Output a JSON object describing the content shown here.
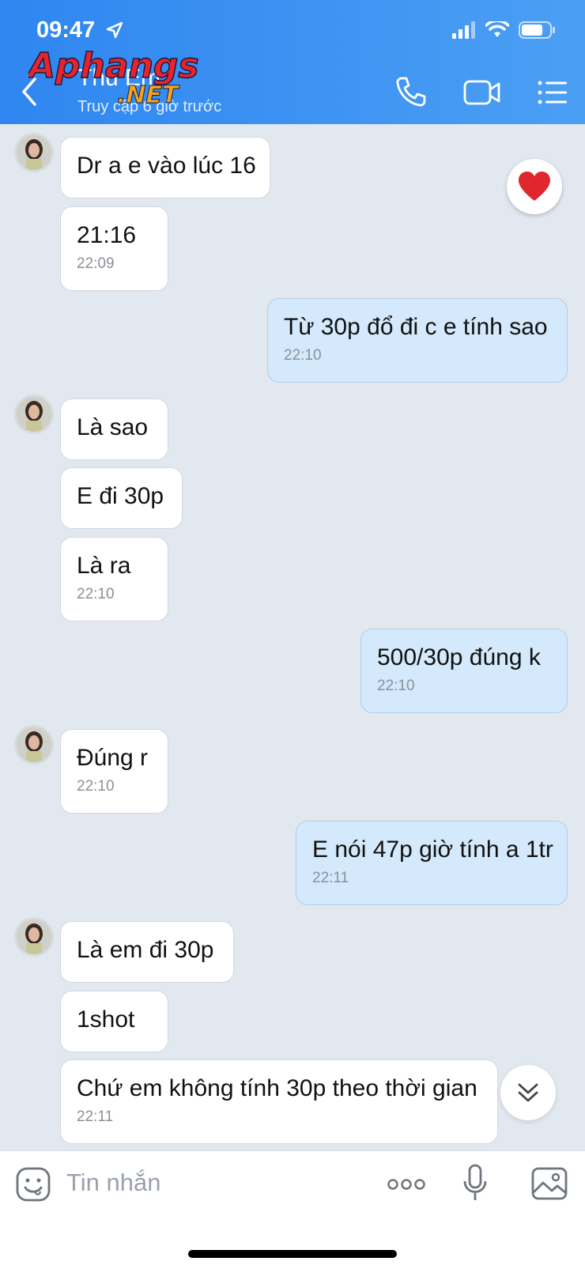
{
  "status_bar": {
    "time": "09:47"
  },
  "header": {
    "contact_name": "Thu Em",
    "contact_status": "Truy cập 6 giờ trước",
    "logo_text": "Aphangs .NET"
  },
  "messages": [
    {
      "text": "Dr a e vào lúc 16",
      "time": ""
    },
    {
      "text": "21:16",
      "time": "22:09"
    },
    {
      "text": "Từ 30p đổ đi c e tính sao",
      "time": "22:10"
    },
    {
      "text": "Là sao",
      "time": ""
    },
    {
      "text": "E đi 30p",
      "time": ""
    },
    {
      "text": "Là ra",
      "time": "22:10"
    },
    {
      "text": "500/30p đúng k",
      "time": "22:10"
    },
    {
      "text": "Đúng r",
      "time": "22:10"
    },
    {
      "text": "E nói 47p giờ tính a 1tr",
      "time": "22:11"
    },
    {
      "text": "Là em đi 30p",
      "time": ""
    },
    {
      "text": "1shot",
      "time": ""
    },
    {
      "text": "Chứ em không tính 30p theo thời gian",
      "time": "22:11"
    }
  ],
  "input": {
    "placeholder": "Tin nhắn"
  },
  "icons": {
    "back": "chevron-left-icon",
    "phone": "phone-icon",
    "video": "video-camera-icon",
    "menu": "list-menu-icon",
    "heart": "heart-reaction-icon",
    "scroll": "double-chevron-down-icon",
    "emoji": "emoji-icon",
    "more": "more-dots-icon",
    "mic": "microphone-icon",
    "image": "image-icon"
  },
  "colors": {
    "header": "#3a8ff1",
    "my_bubble": "#d4e9fb",
    "their_bubble": "#ffffff",
    "background": "#e2e8f0"
  }
}
